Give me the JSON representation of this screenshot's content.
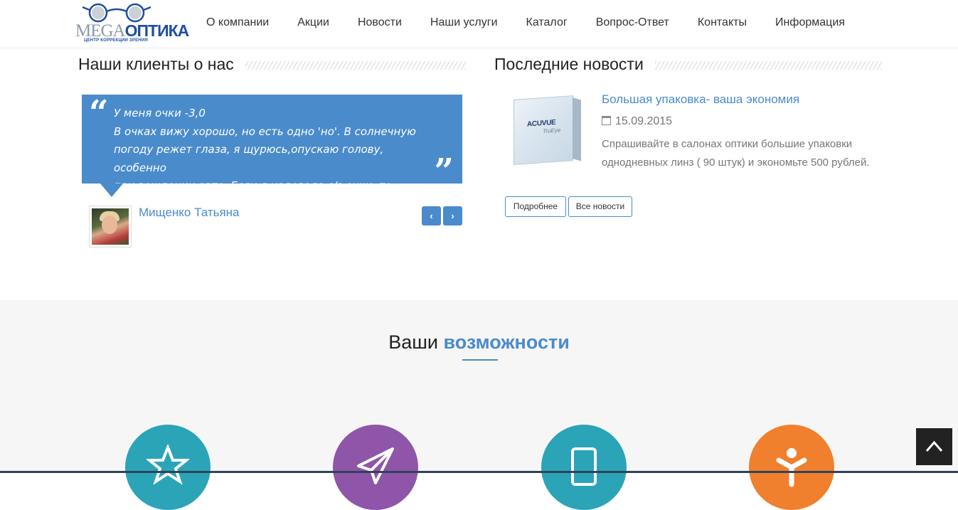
{
  "header": {
    "logo": {
      "brand_left": "MEGA",
      "brand_right": "ОПТИКА",
      "tagline": "ЦЕНТР КОРРЕКЦИИ ЗРЕНИЯ"
    },
    "nav": [
      {
        "label": "О компании"
      },
      {
        "label": "Акции"
      },
      {
        "label": "Новости"
      },
      {
        "label": "Наши услуги"
      },
      {
        "label": "Каталог"
      },
      {
        "label": "Вопрос-Ответ"
      },
      {
        "label": "Контакты"
      },
      {
        "label": "Информация"
      }
    ]
  },
  "testimonials": {
    "title": "Наши клиенты о нас",
    "quote_open": "“",
    "quote_close": "”",
    "quote_lines": [
      "У меня очки -3,0",
      "В очках вижу хорошо, но есть одно 'но'. В солнечную",
      "погоду режет глаза, я щурюсь,опускаю голову, особенно",
      "при вождении авто. Если я надевала с/з очки, то ничего..."
    ],
    "author": "Мищенко Татьяна",
    "prev_symbol": "‹",
    "next_symbol": "›"
  },
  "news": {
    "title": "Последние новости",
    "item": {
      "title": "Большая упаковка- ваша экономия",
      "date": "15.09.2015",
      "text": "Спрашивайте в салонах оптики большие упаковки однодневных линз ( 90 штук) и экономьте 500 рублей.",
      "image_label": "ACUVUE",
      "image_sublabel": "TruEye"
    },
    "more_button": "Подробнее",
    "all_button": "Все новости"
  },
  "features": {
    "title_plain": "Ваши",
    "title_accent": "возможности",
    "items": [
      {
        "icon": "star-icon",
        "color": "#2ba4b8"
      },
      {
        "icon": "paper-plane-icon",
        "color": "#8e55a8"
      },
      {
        "icon": "mobile-icon",
        "color": "#2ba4b8"
      },
      {
        "icon": "person-icon",
        "color": "#f0802e"
      }
    ]
  },
  "colors": {
    "accent": "#4a8bcb",
    "back_to_top": "#222222"
  }
}
